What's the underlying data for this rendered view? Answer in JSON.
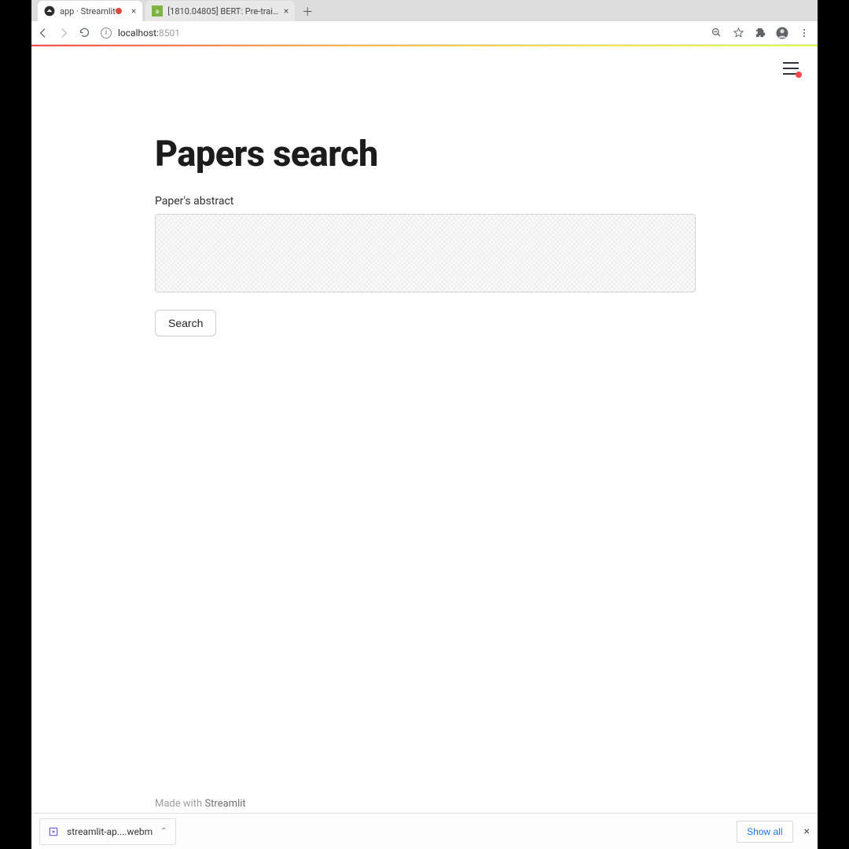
{
  "browser": {
    "tabs": [
      {
        "title": "app · Streamlit",
        "active": true,
        "recording": true
      },
      {
        "title": "[1810.04805] BERT: Pre-train...",
        "active": false,
        "recording": false
      }
    ],
    "address": {
      "host": "localhost:",
      "port": "8501"
    }
  },
  "streamlit_menu": {
    "running": true
  },
  "page": {
    "title": "Papers search",
    "abstract_label": "Paper's abstract",
    "abstract_value": "",
    "search_label": "Search"
  },
  "footer": {
    "prefix": "Made with ",
    "link": "Streamlit"
  },
  "downloads": {
    "item_name": "streamlit-ap....webm",
    "show_all": "Show all"
  }
}
